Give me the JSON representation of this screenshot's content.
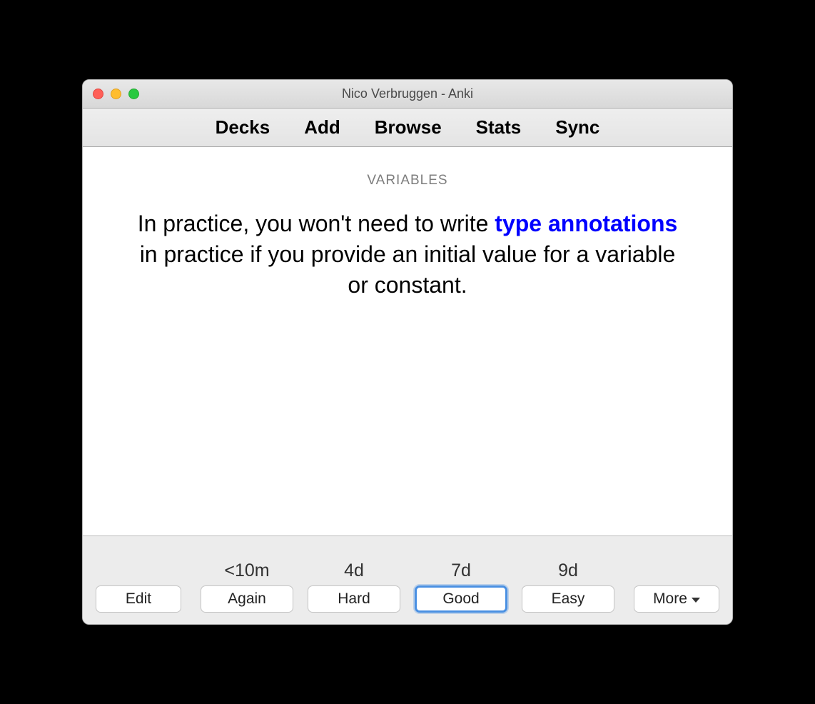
{
  "window": {
    "title": "Nico Verbruggen - Anki"
  },
  "toolbar": {
    "items": [
      "Decks",
      "Add",
      "Browse",
      "Stats",
      "Sync"
    ]
  },
  "card": {
    "category": "VARIABLES",
    "text_before": "In practice, you won't need to write ",
    "cloze": "type annotations",
    "text_after": " in practice if you provide an initial value for a variable or constant."
  },
  "bottom": {
    "edit": "Edit",
    "more": "More",
    "answers": [
      {
        "interval": "<10m",
        "label": "Again"
      },
      {
        "interval": "4d",
        "label": "Hard"
      },
      {
        "interval": "7d",
        "label": "Good"
      },
      {
        "interval": "9d",
        "label": "Easy"
      }
    ],
    "focused_index": 2
  }
}
